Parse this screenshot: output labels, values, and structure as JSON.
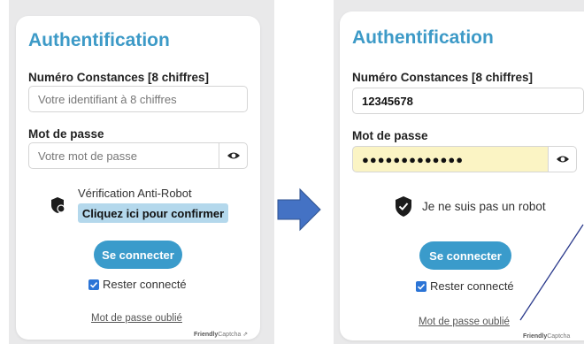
{
  "left": {
    "title": "Authentification",
    "id_label": "Numéro Constances [8 chiffres]",
    "id_placeholder": "Votre identifiant à 8 chiffres",
    "pw_label": "Mot de passe",
    "pw_placeholder": "Votre mot de passe",
    "captcha_title": "Vérification Anti-Robot",
    "captcha_button": "Cliquez ici pour confirmer",
    "connect_button": "Se connecter",
    "remember_label": "Rester connecté",
    "forgot_link": "Mot de passe oublié",
    "brand_bold": "Friendly",
    "brand_rest": "Captcha"
  },
  "right": {
    "title": "Authentification",
    "id_label": "Numéro Constances [8 chiffres]",
    "id_value": "12345678",
    "pw_label": "Mot de passe",
    "pw_value": "●●●●●●●●●●●●●",
    "captcha_done": "Je ne suis pas un robot",
    "connect_button": "Se connecter",
    "remember_label": "Rester connecté",
    "forgot_link": "Mot de passe oublié",
    "brand_bold": "Friendly",
    "brand_rest": "Captcha"
  },
  "colors": {
    "accent": "#3a9bcb",
    "title": "#3d9ac7",
    "arrow": "#4472c4",
    "autofill": "#fbf4c4",
    "captcha_button": "#b4d8ec",
    "annotation_line": "#2b3a8c"
  }
}
